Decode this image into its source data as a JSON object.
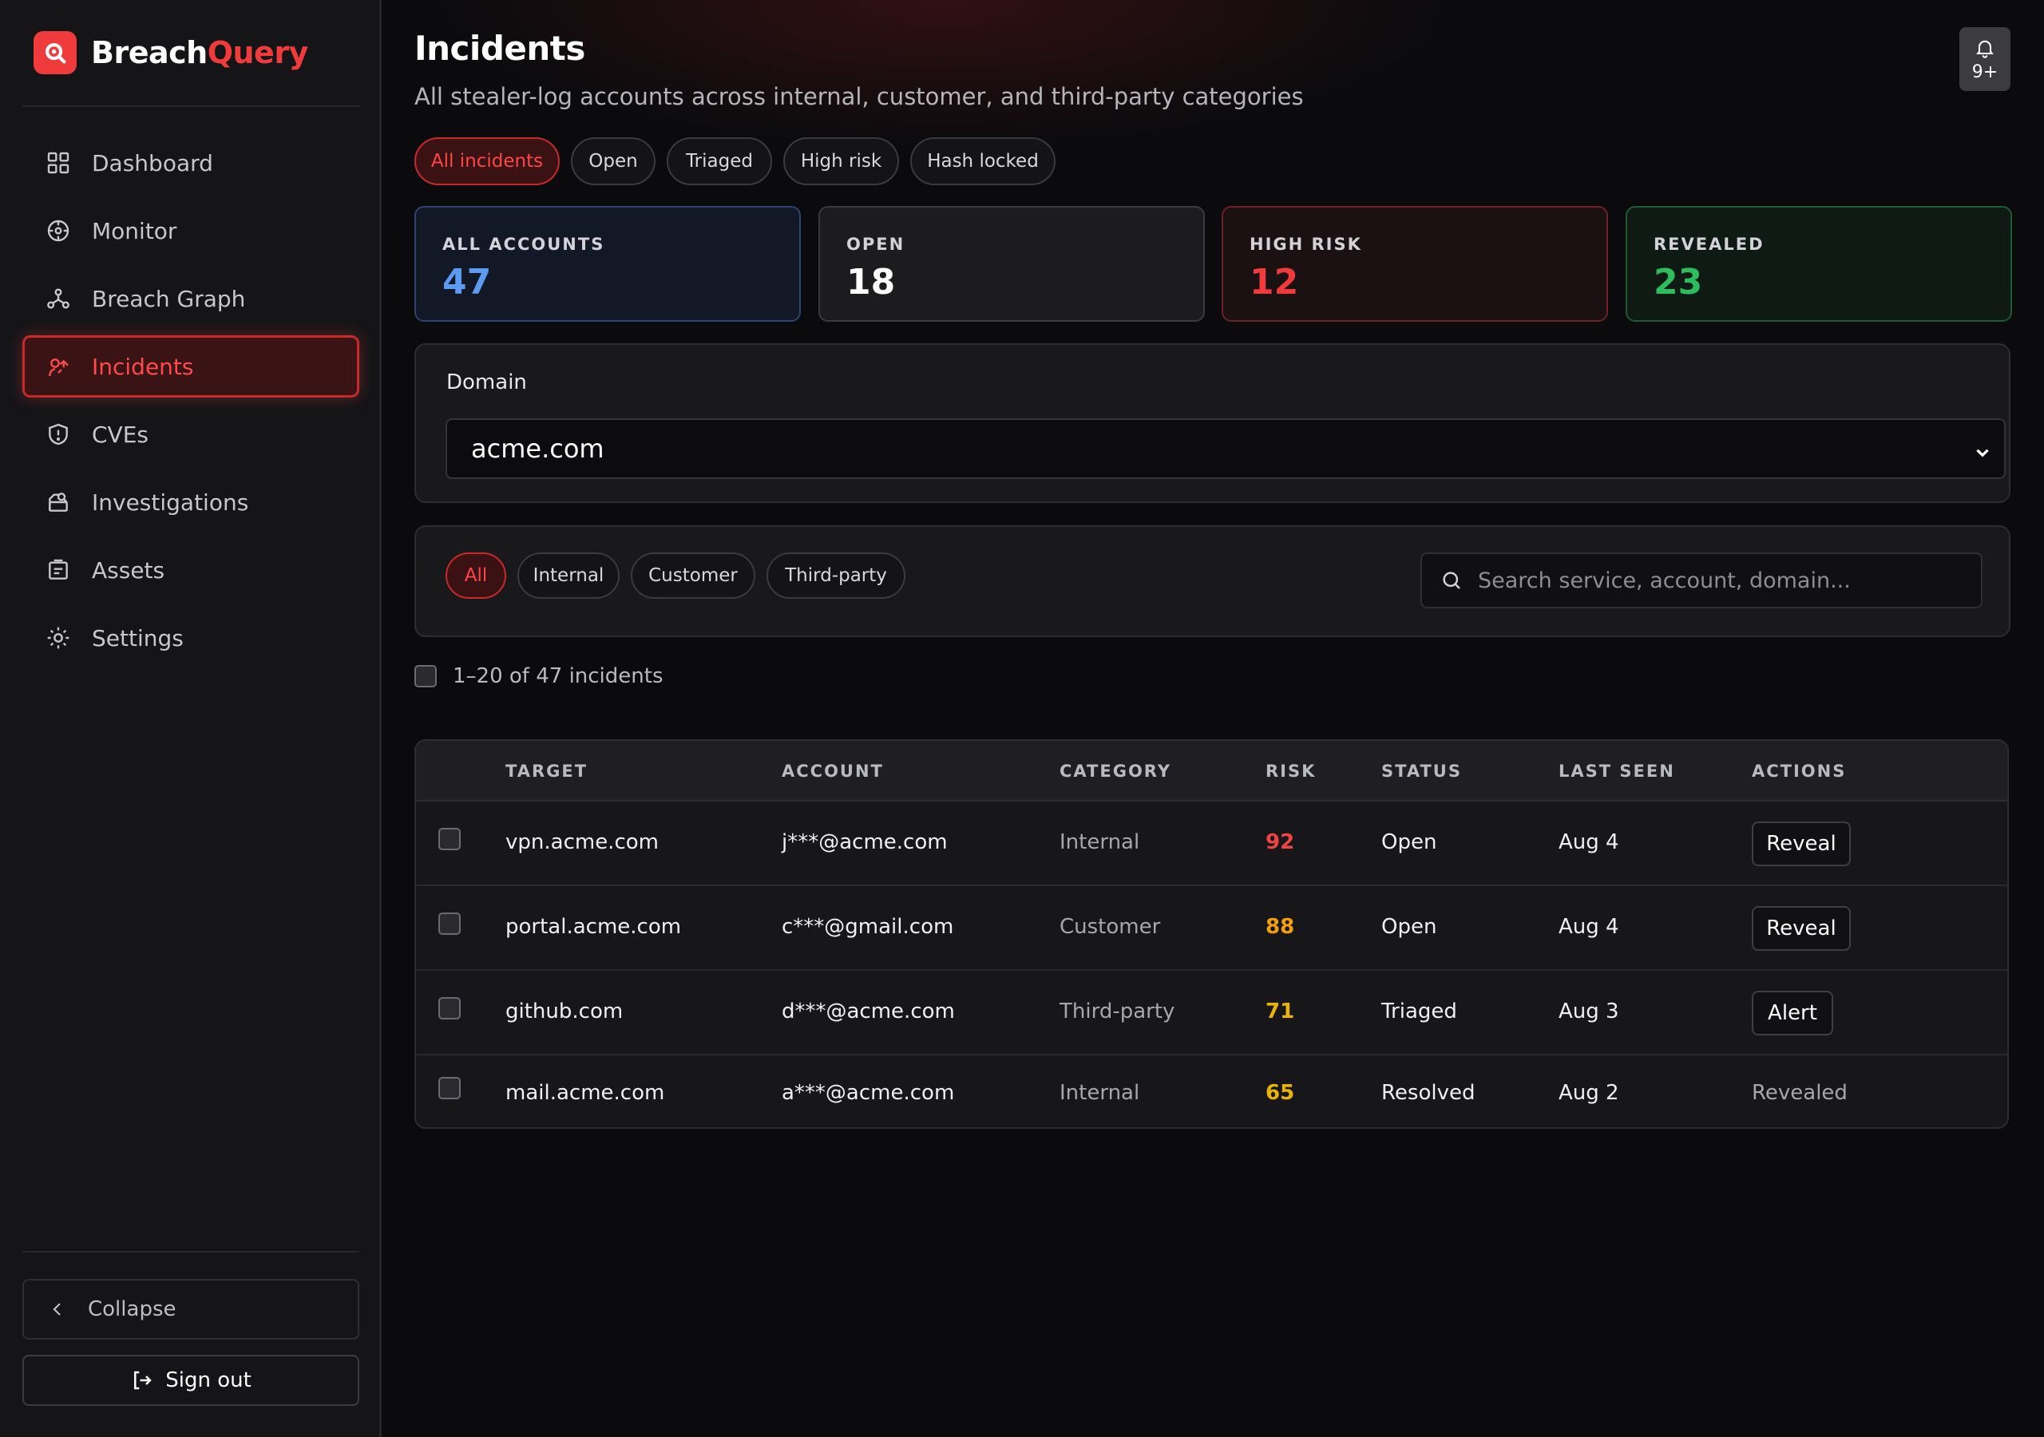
{
  "brand": {
    "name": "Breach",
    "accent": "Query",
    "color": "#ef3b3b"
  },
  "sidebar": {
    "items": [
      {
        "label": "Dashboard",
        "icon": "dashboard-grid-icon",
        "active": false
      },
      {
        "label": "Monitor",
        "icon": "crosshair-icon",
        "active": false
      },
      {
        "label": "Breach Graph",
        "icon": "graph-nodes-icon",
        "active": false
      },
      {
        "label": "Incidents",
        "icon": "incident-icon",
        "active": true
      },
      {
        "label": "CVEs",
        "icon": "shield-alert-icon",
        "active": false
      },
      {
        "label": "Investigations",
        "icon": "investigation-icon",
        "active": false
      },
      {
        "label": "Assets",
        "icon": "assets-icon",
        "active": false
      },
      {
        "label": "Settings",
        "icon": "settings-icon",
        "active": false
      }
    ],
    "collapse_label": "Collapse",
    "signout_label": "Sign out"
  },
  "header": {
    "title": "Incidents",
    "subtitle": "All stealer-log accounts across internal, customer, and third-party categories",
    "notifications": "9+"
  },
  "filters": {
    "status_chips": [
      "All incidents",
      "Open",
      "Triaged",
      "High risk",
      "Hash locked"
    ],
    "active_status": "All incidents",
    "category_chips": [
      "All",
      "Internal",
      "Customer",
      "Third-party"
    ],
    "active_category": "All"
  },
  "stats": [
    {
      "label": "ALL ACCOUNTS",
      "value": "47",
      "color": "#5b9bf2"
    },
    {
      "label": "OPEN",
      "value": "18",
      "color": "#ffffff"
    },
    {
      "label": "HIGH RISK",
      "value": "12",
      "color": "#ef3b3b"
    },
    {
      "label": "REVEALED",
      "value": "23",
      "color": "#2dbd5c"
    }
  ],
  "domain": {
    "label": "Domain",
    "selected": "acme.com"
  },
  "search": {
    "placeholder": "Search service, account, domain..."
  },
  "results": {
    "count_text": "1–20 of 47 incidents"
  },
  "table": {
    "columns": [
      "TARGET",
      "ACCOUNT",
      "CATEGORY",
      "RISK",
      "STATUS",
      "LAST SEEN",
      "ACTIONS"
    ],
    "rows": [
      {
        "target": "vpn.acme.com",
        "account": "j***@acme.com",
        "category": "Internal",
        "risk": "92",
        "risk_color": "#ef4444",
        "status": "Open",
        "last_seen": "Aug 4",
        "action": "Reveal",
        "action_type": "button"
      },
      {
        "target": "portal.acme.com",
        "account": "c***@gmail.com",
        "category": "Customer",
        "risk": "88",
        "risk_color": "#f59e0b",
        "status": "Open",
        "last_seen": "Aug 4",
        "action": "Reveal",
        "action_type": "button"
      },
      {
        "target": "github.com",
        "account": "d***@acme.com",
        "category": "Third-party",
        "risk": "71",
        "risk_color": "#eab308",
        "status": "Triaged",
        "last_seen": "Aug 3",
        "action": "Alert",
        "action_type": "button"
      },
      {
        "target": "mail.acme.com",
        "account": "a***@acme.com",
        "category": "Internal",
        "risk": "65",
        "risk_color": "#eab308",
        "status": "Resolved",
        "last_seen": "Aug 2",
        "action": "Revealed",
        "action_type": "text"
      }
    ]
  }
}
